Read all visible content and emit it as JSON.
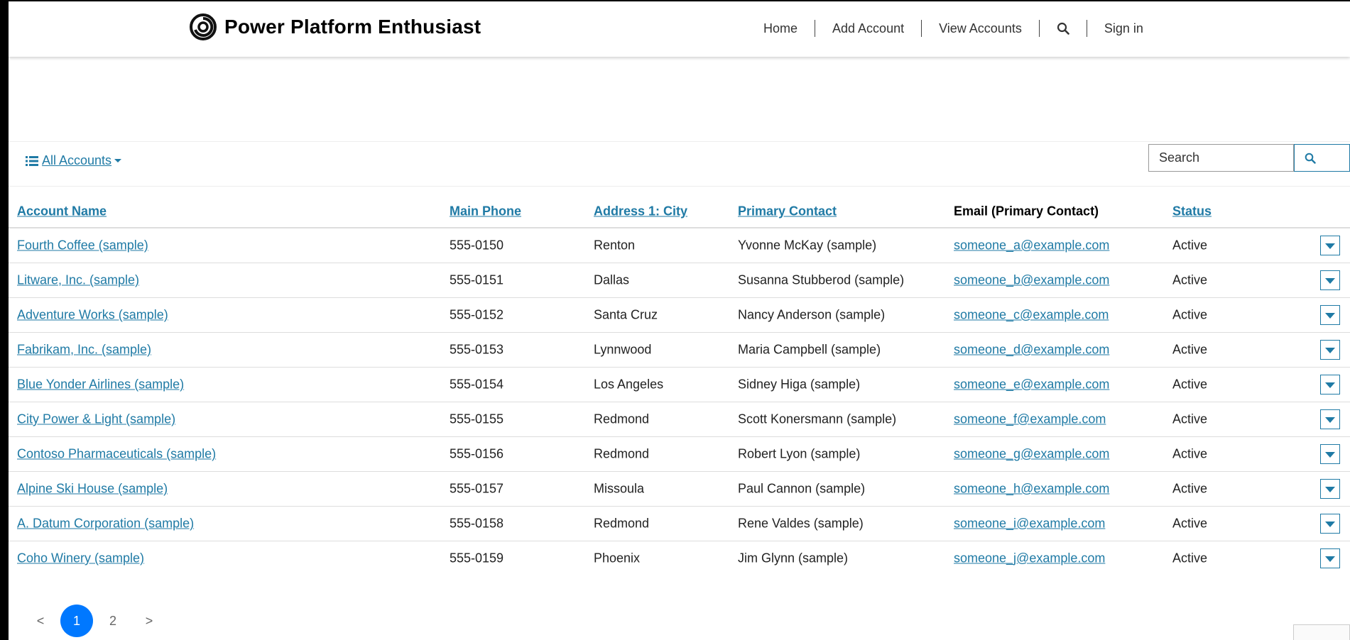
{
  "header": {
    "brand_title": "Power Platform Enthusiast",
    "nav": {
      "home": "Home",
      "add_account": "Add Account",
      "view_accounts": "View Accounts",
      "sign_in": "Sign in"
    }
  },
  "toolbar": {
    "view_label": "All Accounts",
    "search_placeholder": "Search"
  },
  "table": {
    "columns": {
      "account_name": "Account Name",
      "main_phone": "Main Phone",
      "city": "Address 1: City",
      "primary_contact": "Primary Contact",
      "email": "Email (Primary Contact)",
      "status": "Status"
    },
    "rows": [
      {
        "name": "Fourth Coffee (sample)",
        "phone": "555-0150",
        "city": "Renton",
        "contact": "Yvonne McKay (sample)",
        "email": "someone_a@example.com",
        "status": "Active"
      },
      {
        "name": "Litware, Inc. (sample)",
        "phone": "555-0151",
        "city": "Dallas",
        "contact": "Susanna Stubberod (sample)",
        "email": "someone_b@example.com",
        "status": "Active"
      },
      {
        "name": "Adventure Works (sample)",
        "phone": "555-0152",
        "city": "Santa Cruz",
        "contact": "Nancy Anderson (sample)",
        "email": "someone_c@example.com",
        "status": "Active"
      },
      {
        "name": "Fabrikam, Inc. (sample)",
        "phone": "555-0153",
        "city": "Lynnwood",
        "contact": "Maria Campbell (sample)",
        "email": "someone_d@example.com",
        "status": "Active"
      },
      {
        "name": "Blue Yonder Airlines (sample)",
        "phone": "555-0154",
        "city": "Los Angeles",
        "contact": "Sidney Higa (sample)",
        "email": "someone_e@example.com",
        "status": "Active"
      },
      {
        "name": "City Power & Light (sample)",
        "phone": "555-0155",
        "city": "Redmond",
        "contact": "Scott Konersmann (sample)",
        "email": "someone_f@example.com",
        "status": "Active"
      },
      {
        "name": "Contoso Pharmaceuticals (sample)",
        "phone": "555-0156",
        "city": "Redmond",
        "contact": "Robert Lyon (sample)",
        "email": "someone_g@example.com",
        "status": "Active"
      },
      {
        "name": "Alpine Ski House (sample)",
        "phone": "555-0157",
        "city": "Missoula",
        "contact": "Paul Cannon (sample)",
        "email": "someone_h@example.com",
        "status": "Active"
      },
      {
        "name": "A. Datum Corporation (sample)",
        "phone": "555-0158",
        "city": "Redmond",
        "contact": "Rene Valdes (sample)",
        "email": "someone_i@example.com",
        "status": "Active"
      },
      {
        "name": "Coho Winery (sample)",
        "phone": "555-0159",
        "city": "Phoenix",
        "contact": "Jim Glynn (sample)",
        "email": "someone_j@example.com",
        "status": "Active"
      }
    ]
  },
  "pagination": {
    "prev": "<",
    "pages": [
      "1",
      "2"
    ],
    "next": ">",
    "current": "1"
  },
  "colors": {
    "link": "#1f7aa5",
    "active_page": "#0078ff"
  }
}
